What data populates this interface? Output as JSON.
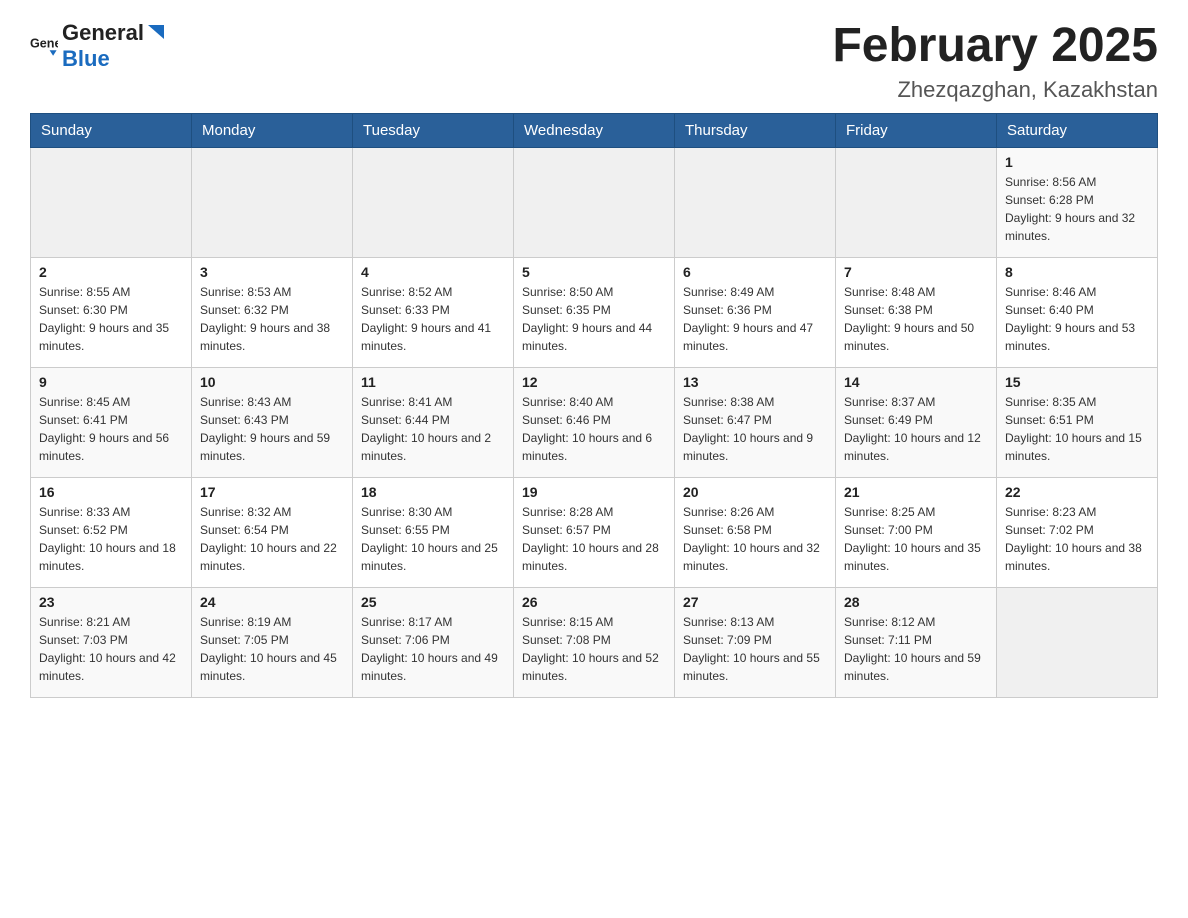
{
  "header": {
    "logo_general": "General",
    "logo_blue": "Blue",
    "month_title": "February 2025",
    "location": "Zhezqazghan, Kazakhstan"
  },
  "weekdays": [
    "Sunday",
    "Monday",
    "Tuesday",
    "Wednesday",
    "Thursday",
    "Friday",
    "Saturday"
  ],
  "weeks": [
    [
      {
        "day": "",
        "info": ""
      },
      {
        "day": "",
        "info": ""
      },
      {
        "day": "",
        "info": ""
      },
      {
        "day": "",
        "info": ""
      },
      {
        "day": "",
        "info": ""
      },
      {
        "day": "",
        "info": ""
      },
      {
        "day": "1",
        "info": "Sunrise: 8:56 AM\nSunset: 6:28 PM\nDaylight: 9 hours and 32 minutes."
      }
    ],
    [
      {
        "day": "2",
        "info": "Sunrise: 8:55 AM\nSunset: 6:30 PM\nDaylight: 9 hours and 35 minutes."
      },
      {
        "day": "3",
        "info": "Sunrise: 8:53 AM\nSunset: 6:32 PM\nDaylight: 9 hours and 38 minutes."
      },
      {
        "day": "4",
        "info": "Sunrise: 8:52 AM\nSunset: 6:33 PM\nDaylight: 9 hours and 41 minutes."
      },
      {
        "day": "5",
        "info": "Sunrise: 8:50 AM\nSunset: 6:35 PM\nDaylight: 9 hours and 44 minutes."
      },
      {
        "day": "6",
        "info": "Sunrise: 8:49 AM\nSunset: 6:36 PM\nDaylight: 9 hours and 47 minutes."
      },
      {
        "day": "7",
        "info": "Sunrise: 8:48 AM\nSunset: 6:38 PM\nDaylight: 9 hours and 50 minutes."
      },
      {
        "day": "8",
        "info": "Sunrise: 8:46 AM\nSunset: 6:40 PM\nDaylight: 9 hours and 53 minutes."
      }
    ],
    [
      {
        "day": "9",
        "info": "Sunrise: 8:45 AM\nSunset: 6:41 PM\nDaylight: 9 hours and 56 minutes."
      },
      {
        "day": "10",
        "info": "Sunrise: 8:43 AM\nSunset: 6:43 PM\nDaylight: 9 hours and 59 minutes."
      },
      {
        "day": "11",
        "info": "Sunrise: 8:41 AM\nSunset: 6:44 PM\nDaylight: 10 hours and 2 minutes."
      },
      {
        "day": "12",
        "info": "Sunrise: 8:40 AM\nSunset: 6:46 PM\nDaylight: 10 hours and 6 minutes."
      },
      {
        "day": "13",
        "info": "Sunrise: 8:38 AM\nSunset: 6:47 PM\nDaylight: 10 hours and 9 minutes."
      },
      {
        "day": "14",
        "info": "Sunrise: 8:37 AM\nSunset: 6:49 PM\nDaylight: 10 hours and 12 minutes."
      },
      {
        "day": "15",
        "info": "Sunrise: 8:35 AM\nSunset: 6:51 PM\nDaylight: 10 hours and 15 minutes."
      }
    ],
    [
      {
        "day": "16",
        "info": "Sunrise: 8:33 AM\nSunset: 6:52 PM\nDaylight: 10 hours and 18 minutes."
      },
      {
        "day": "17",
        "info": "Sunrise: 8:32 AM\nSunset: 6:54 PM\nDaylight: 10 hours and 22 minutes."
      },
      {
        "day": "18",
        "info": "Sunrise: 8:30 AM\nSunset: 6:55 PM\nDaylight: 10 hours and 25 minutes."
      },
      {
        "day": "19",
        "info": "Sunrise: 8:28 AM\nSunset: 6:57 PM\nDaylight: 10 hours and 28 minutes."
      },
      {
        "day": "20",
        "info": "Sunrise: 8:26 AM\nSunset: 6:58 PM\nDaylight: 10 hours and 32 minutes."
      },
      {
        "day": "21",
        "info": "Sunrise: 8:25 AM\nSunset: 7:00 PM\nDaylight: 10 hours and 35 minutes."
      },
      {
        "day": "22",
        "info": "Sunrise: 8:23 AM\nSunset: 7:02 PM\nDaylight: 10 hours and 38 minutes."
      }
    ],
    [
      {
        "day": "23",
        "info": "Sunrise: 8:21 AM\nSunset: 7:03 PM\nDaylight: 10 hours and 42 minutes."
      },
      {
        "day": "24",
        "info": "Sunrise: 8:19 AM\nSunset: 7:05 PM\nDaylight: 10 hours and 45 minutes."
      },
      {
        "day": "25",
        "info": "Sunrise: 8:17 AM\nSunset: 7:06 PM\nDaylight: 10 hours and 49 minutes."
      },
      {
        "day": "26",
        "info": "Sunrise: 8:15 AM\nSunset: 7:08 PM\nDaylight: 10 hours and 52 minutes."
      },
      {
        "day": "27",
        "info": "Sunrise: 8:13 AM\nSunset: 7:09 PM\nDaylight: 10 hours and 55 minutes."
      },
      {
        "day": "28",
        "info": "Sunrise: 8:12 AM\nSunset: 7:11 PM\nDaylight: 10 hours and 59 minutes."
      },
      {
        "day": "",
        "info": ""
      }
    ]
  ]
}
